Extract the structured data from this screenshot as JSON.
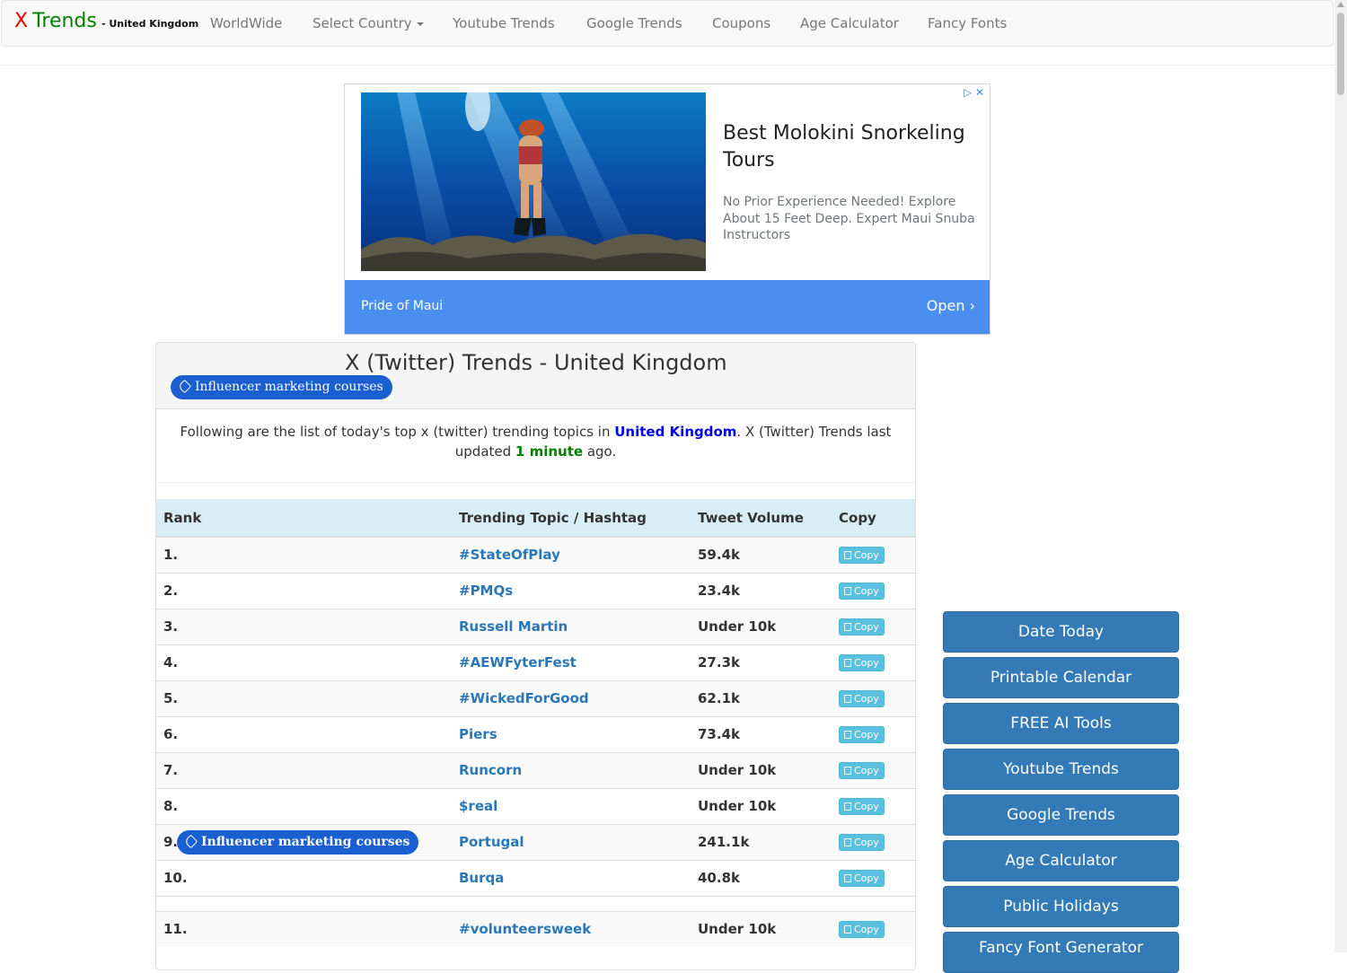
{
  "navbar": {
    "brand_x": "X",
    "brand_trends": "Trends",
    "brand_country": "- United Kingdom",
    "items": [
      {
        "label": "WorldWide"
      },
      {
        "label": "Select Country"
      },
      {
        "label": "Youtube Trends"
      },
      {
        "label": "Google Trends"
      },
      {
        "label": "Coupons"
      },
      {
        "label": "Age Calculator"
      },
      {
        "label": "Fancy Fonts"
      }
    ]
  },
  "ad": {
    "title": "Best Molokini Snorkeling Tours",
    "description": "No Prior Experience Needed! Explore About 15 Feet Deep. Expert Maui Snuba Instructors",
    "advertiser": "Pride of Maui",
    "cta": "Open",
    "adchoices_icon": "play-triangle-icon",
    "close_icon": "close-icon"
  },
  "panel": {
    "title": "X (Twitter) Trends - United Kingdom",
    "tag_label": "Influencer marketing courses",
    "intro_prefix": "Following are the list of today's top x (twitter) trending topics in ",
    "intro_country": "United Kingdom",
    "intro_middle": ". X (Twitter) Trends last updated ",
    "intro_minutes": "1 minute",
    "intro_suffix": " ago."
  },
  "table": {
    "headers": {
      "rank": "Rank",
      "topic": "Trending Topic / Hashtag",
      "volume": "Tweet Volume",
      "copy": "Copy"
    },
    "copy_label": "Copy",
    "rows": [
      {
        "rank": "1.",
        "topic": "#StateOfPlay",
        "volume": "59.4k"
      },
      {
        "rank": "2.",
        "topic": "#PMQs",
        "volume": "23.4k"
      },
      {
        "rank": "3.",
        "topic": "Russell Martin",
        "volume": "Under 10k"
      },
      {
        "rank": "4.",
        "topic": "#AEWFyterFest",
        "volume": "27.3k"
      },
      {
        "rank": "5.",
        "topic": "#WickedForGood",
        "volume": "62.1k"
      },
      {
        "rank": "6.",
        "topic": "Piers",
        "volume": "73.4k"
      },
      {
        "rank": "7.",
        "topic": "Runcorn",
        "volume": "Under 10k"
      },
      {
        "rank": "8.",
        "topic": "$real",
        "volume": "Under 10k"
      },
      {
        "rank": "9.",
        "topic": "Portugal",
        "volume": "241.1k",
        "tag_label": "Influencer marketing courses"
      },
      {
        "rank": "10.",
        "topic": "Burqa",
        "volume": "40.8k"
      },
      {
        "rank": "11.",
        "topic": "#volunteersweek",
        "volume": "Under 10k"
      }
    ]
  },
  "sidebar": {
    "buttons": [
      {
        "label": "Date Today"
      },
      {
        "label": "Printable Calendar"
      },
      {
        "label": "FREE AI Tools"
      },
      {
        "label": "Youtube Trends"
      },
      {
        "label": "Google Trends"
      },
      {
        "label": "Age Calculator"
      },
      {
        "label": "Public Holidays"
      },
      {
        "label": "Fancy Font Generator"
      }
    ]
  }
}
